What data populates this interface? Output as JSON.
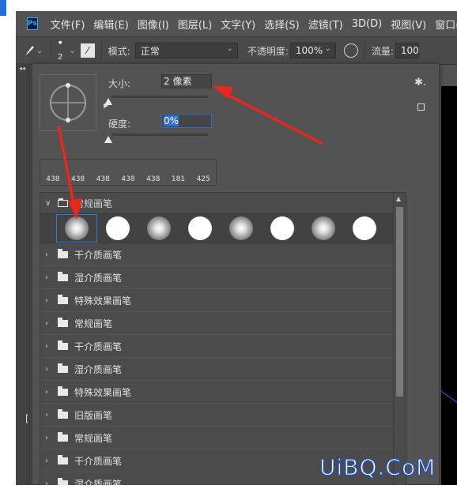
{
  "app": {
    "logo": "Ps",
    "menus": [
      "文件(F)",
      "编辑(E)",
      "图像(I)",
      "图层(L)",
      "文字(Y)",
      "选择(S)",
      "滤镜(T)",
      "3D(D)",
      "视图(V)",
      "窗口("
    ]
  },
  "options_bar": {
    "brush_size": "2",
    "mode_label": "模式:",
    "mode_value": "正常",
    "opacity_label": "不透明度:",
    "opacity_value": "100%",
    "flow_label": "流量:",
    "flow_value": "100"
  },
  "brush_panel": {
    "size_label": "大小:",
    "size_value": "2 像素",
    "hardness_label": "硬度:",
    "hardness_value": "0%",
    "recent_sizes": [
      "438",
      "438",
      "438",
      "438",
      "438",
      "181",
      "425"
    ],
    "group_open_name": "常规画笔",
    "tips": [
      "soft",
      "hard",
      "soft",
      "hard",
      "soft",
      "hard",
      "soft",
      "hard"
    ],
    "selected_tip_index": 0,
    "folders": [
      "干介质画笔",
      "湿介质画笔",
      "特殊效果画笔",
      "常规画笔",
      "干介质画笔",
      "湿介质画笔",
      "特殊效果画笔",
      "旧版画笔",
      "常规画笔",
      "干介质画笔",
      "湿介质画笔"
    ]
  },
  "watermark": "UiBQ.CoM",
  "colors": {
    "annotation_arrow": "#e8271d",
    "panel_bg": "#535353",
    "accent_blue": "#2f7cd6"
  }
}
